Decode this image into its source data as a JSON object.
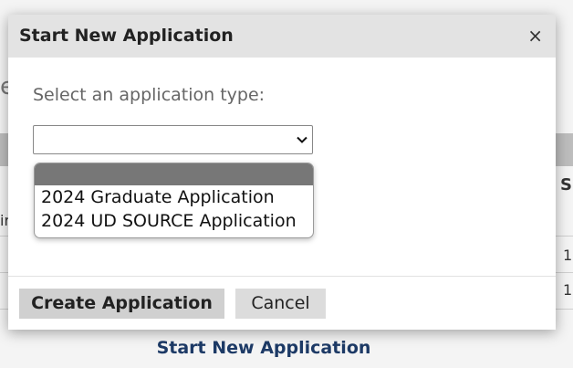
{
  "background": {
    "fragment_e": "e",
    "fragment_ir": "ir",
    "fragment_s": "S",
    "fragment_num1": "1",
    "fragment_num2": "1",
    "link": "Start New Application"
  },
  "modal": {
    "title": "Start New Application",
    "close": "×",
    "prompt": "Select an application type:",
    "select": {
      "value": "",
      "options": [
        "",
        "2024 Graduate Application",
        "2024 UD SOURCE Application"
      ]
    },
    "create_label": "Create Application",
    "cancel_label": "Cancel"
  },
  "colors": {
    "header_bg": "#e3e3e3",
    "link": "#1d3a66",
    "selected_option": "#777777"
  }
}
